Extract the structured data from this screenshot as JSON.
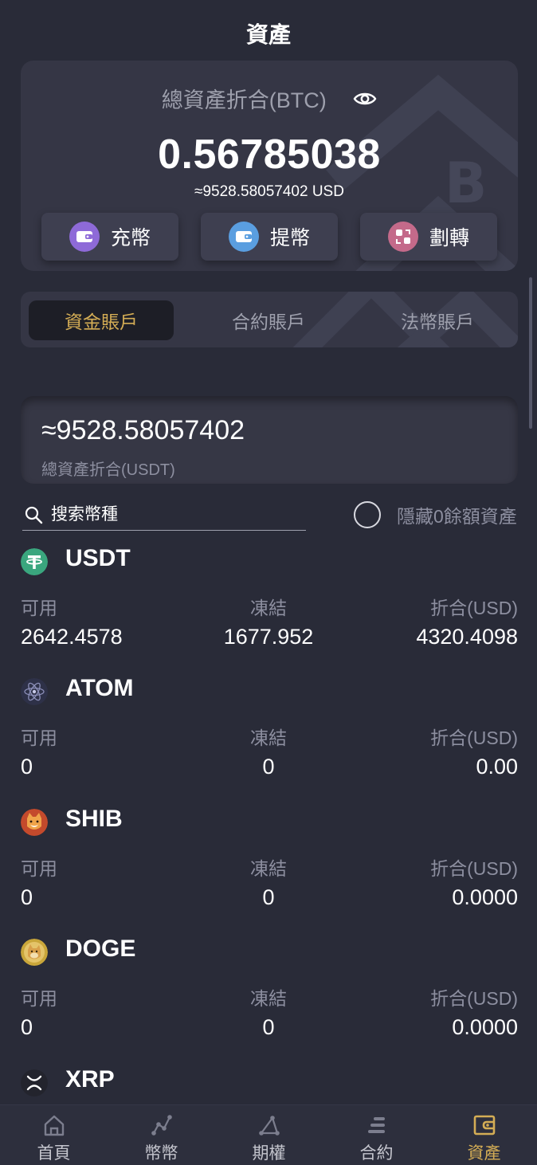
{
  "header": {
    "title": "資產"
  },
  "summary": {
    "label": "總資產折合(BTC)",
    "btc_value": "0.56785038",
    "usd_value": "≈9528.58057402 USD",
    "actions": [
      {
        "label": "充幣",
        "icon": "wallet-in-icon",
        "color": "#8e6ad8"
      },
      {
        "label": "提幣",
        "icon": "wallet-out-icon",
        "color": "#5a9ee0"
      },
      {
        "label": "劃轉",
        "icon": "transfer-icon",
        "color": "#c46a8a"
      }
    ]
  },
  "account_tabs": [
    {
      "label": "資金賬戶",
      "active": true
    },
    {
      "label": "合約賬戶",
      "active": false
    },
    {
      "label": "法幣賬戶",
      "active": false
    }
  ],
  "usdt_total": {
    "value": "≈9528.58057402",
    "label": "總資產折合(USDT)"
  },
  "search": {
    "placeholder": "搜索幣種",
    "hide_zero_label": "隱藏0餘額資產"
  },
  "columns": {
    "available": "可用",
    "frozen": "凍結",
    "equivalent": "折合(USD)"
  },
  "coins": [
    {
      "symbol": "USDT",
      "available": "2642.4578",
      "frozen": "1677.952",
      "equivalent": "4320.4098"
    },
    {
      "symbol": "ATOM",
      "available": "0",
      "frozen": "0",
      "equivalent": "0.00"
    },
    {
      "symbol": "SHIB",
      "available": "0",
      "frozen": "0",
      "equivalent": "0.0000"
    },
    {
      "symbol": "DOGE",
      "available": "0",
      "frozen": "0",
      "equivalent": "0.0000"
    },
    {
      "symbol": "XRP"
    }
  ],
  "bottom_nav": [
    {
      "label": "首頁",
      "icon": "home-icon",
      "active": false
    },
    {
      "label": "幣幣",
      "icon": "chart-line-icon",
      "active": false
    },
    {
      "label": "期權",
      "icon": "option-icon",
      "active": false
    },
    {
      "label": "合約",
      "icon": "contract-icon",
      "active": false
    },
    {
      "label": "資產",
      "icon": "wallet-icon",
      "active": true
    }
  ],
  "colors": {
    "background": "#292b38",
    "card": "#353645",
    "accent": "#d4ad55",
    "muted": "#8d8fa0"
  }
}
